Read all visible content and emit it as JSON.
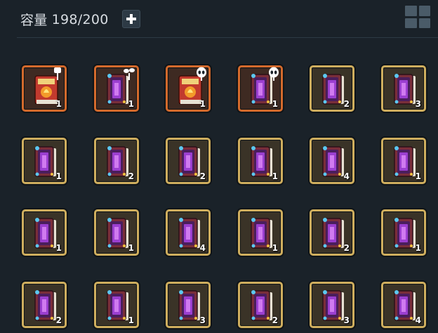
{
  "header": {
    "capacity_label": "容量",
    "capacity_value": "198/200"
  },
  "colors": {
    "background": "#1a2229",
    "orange_frame": "#d46a2c",
    "gold_frame": "#cfae5e"
  },
  "slots": [
    {
      "item": "red-recipe-book",
      "frame": "orange",
      "badge": "spatula-icon",
      "count": "1"
    },
    {
      "item": "arcane-tome",
      "frame": "orange",
      "badge": "sprout-icon",
      "count": "1"
    },
    {
      "item": "red-recipe-book",
      "frame": "orange",
      "badge": "alien-token-icon",
      "count": "1"
    },
    {
      "item": "arcane-tome",
      "frame": "orange",
      "badge": "alien-head-icon",
      "count": "1"
    },
    {
      "item": "arcane-tome",
      "frame": "gold",
      "badge": "",
      "count": "2"
    },
    {
      "item": "arcane-tome",
      "frame": "gold",
      "badge": "",
      "count": "3"
    },
    {
      "item": "arcane-tome",
      "frame": "gold",
      "badge": "",
      "count": "1"
    },
    {
      "item": "arcane-tome",
      "frame": "gold",
      "badge": "",
      "count": "2"
    },
    {
      "item": "arcane-tome",
      "frame": "gold",
      "badge": "",
      "count": "2"
    },
    {
      "item": "arcane-tome",
      "frame": "gold",
      "badge": "",
      "count": "1"
    },
    {
      "item": "arcane-tome",
      "frame": "gold",
      "badge": "",
      "count": "4"
    },
    {
      "item": "arcane-tome",
      "frame": "gold",
      "badge": "",
      "count": "1"
    },
    {
      "item": "arcane-tome",
      "frame": "gold",
      "badge": "",
      "count": "1"
    },
    {
      "item": "arcane-tome",
      "frame": "gold",
      "badge": "",
      "count": "1"
    },
    {
      "item": "arcane-tome",
      "frame": "gold",
      "badge": "",
      "count": "4"
    },
    {
      "item": "arcane-tome",
      "frame": "gold",
      "badge": "",
      "count": "1"
    },
    {
      "item": "arcane-tome",
      "frame": "gold",
      "badge": "",
      "count": "2"
    },
    {
      "item": "arcane-tome",
      "frame": "gold",
      "badge": "",
      "count": "1"
    },
    {
      "item": "arcane-tome",
      "frame": "gold",
      "badge": "",
      "count": "2"
    },
    {
      "item": "arcane-tome",
      "frame": "gold",
      "badge": "",
      "count": "1"
    },
    {
      "item": "arcane-tome",
      "frame": "gold",
      "badge": "",
      "count": "3"
    },
    {
      "item": "arcane-tome",
      "frame": "gold",
      "badge": "",
      "count": "2"
    },
    {
      "item": "arcane-tome",
      "frame": "gold",
      "badge": "",
      "count": "3"
    },
    {
      "item": "arcane-tome",
      "frame": "gold",
      "badge": "",
      "count": "4"
    }
  ]
}
